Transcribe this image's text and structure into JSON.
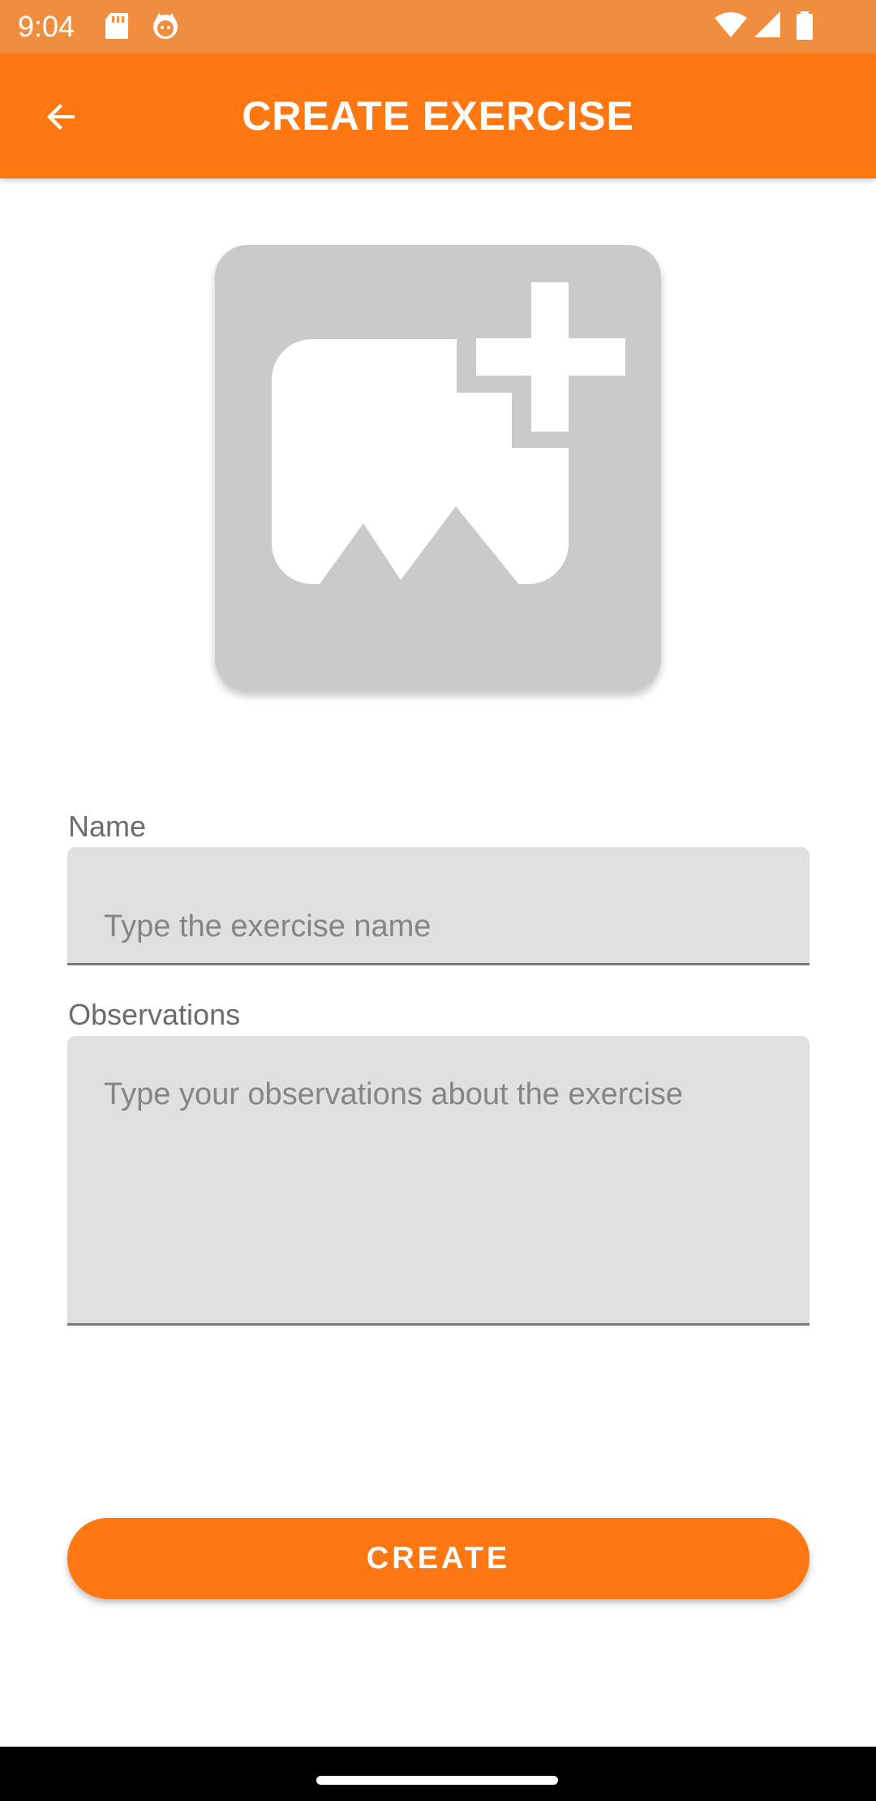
{
  "status_bar": {
    "time": "9:04",
    "icons": [
      "sd-card-icon",
      "cat-notification-icon",
      "wifi-icon",
      "signal-icon",
      "battery-icon"
    ]
  },
  "app_bar": {
    "title": "CREATE EXERCISE",
    "back_icon": "arrow-back-icon",
    "background_color": "#ff7711"
  },
  "image_picker": {
    "icon": "add-photo-icon",
    "background_color": "#cacaca"
  },
  "form": {
    "name": {
      "label": "Name",
      "placeholder": "Type the exercise name",
      "value": ""
    },
    "observations": {
      "label": "Observations",
      "placeholder": "Type your observations about the exercise",
      "value": ""
    }
  },
  "create_button": {
    "label": "CREATE",
    "color": "#ff7711"
  }
}
